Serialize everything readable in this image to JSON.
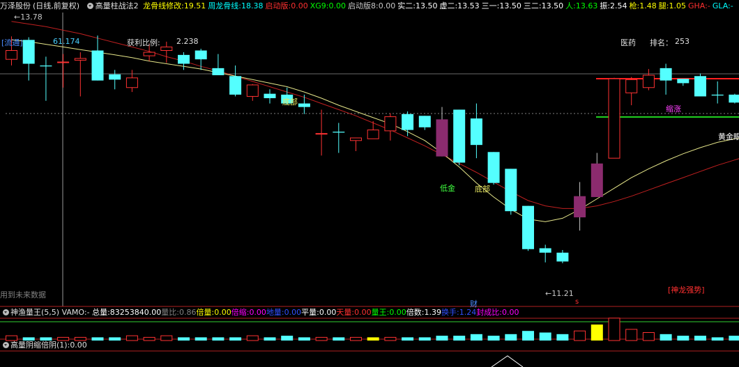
{
  "header": {
    "stock_name": "万泽股份",
    "period": "(日线,前复权)",
    "indicator_name": "高量柱战法2",
    "items": [
      {
        "label": "龙骨线修改:",
        "value": "19.51",
        "color": "#ffff00"
      },
      {
        "label": "周龙骨线:",
        "value": "18.38",
        "color": "#00ffff"
      },
      {
        "label": "启动版:",
        "value": "0.00",
        "color": "#ff3030"
      },
      {
        "label": "XG9:",
        "value": "0.00",
        "color": "#00ff00"
      },
      {
        "label": "启动版8:",
        "value": "0.00",
        "color": "#c8c8c8"
      },
      {
        "label": "实二:",
        "value": "13.50",
        "color": "#ffffff"
      },
      {
        "label": "虚二:",
        "value": "13.53",
        "color": "#ffffff"
      },
      {
        "label": "三一:",
        "value": "13.50",
        "color": "#ffffff"
      },
      {
        "label": "三二:",
        "value": "13.50",
        "color": "#ffffff"
      },
      {
        "label": "人:",
        "value": "13.63",
        "color": "#00ff00"
      },
      {
        "label": "振:",
        "value": "2.54",
        "color": "#ffffff"
      },
      {
        "label": "枪:",
        "value": "1.48",
        "color": "#ffff00"
      },
      {
        "label": "腿:",
        "value": "1.05",
        "color": "#ffff00"
      },
      {
        "label": "GHA:",
        "value": "-",
        "color": "#ff3030"
      },
      {
        "label": "GLA:",
        "value": "-",
        "color": "#00ffff"
      }
    ]
  },
  "main_panel": {
    "price_high_label": "13.78",
    "price_low_label": "11.21",
    "liutong_label": "[流通]",
    "liutong_value": "61.174",
    "profit_ratio_label": "获利比例:",
    "profit_ratio_value": "2.238",
    "sector_name": "医药",
    "rank_label": "排名：",
    "rank_value": "253",
    "future_data_note": "用到未来数据",
    "shenlong_label": "[神龙强势]",
    "annotations": {
      "dibu1": "底部",
      "dibu2": "底部",
      "dijin": "低金",
      "suozhang": "缩涨",
      "huangjin": "黄金眼",
      "cai": "财",
      "s_mark": "s"
    },
    "colors": {
      "up": "#ff3232",
      "down": "#54ffff",
      "ma_yellow": "#e6e68a",
      "ma_red": "#c02020",
      "highlight_candle": "#8b2b6e"
    }
  },
  "volume_panel": {
    "name": "神渔量王(5,5)",
    "vamo_label": "VAMO:",
    "vamo_value": "-",
    "items": [
      {
        "label": "总量:",
        "value": "83253840.00",
        "color": "#ffffff"
      },
      {
        "label": "量比:",
        "value": "0.86",
        "color": "#808080"
      },
      {
        "label": "倍量:",
        "value": "0.00",
        "color": "#ffff00"
      },
      {
        "label": "倍缩:",
        "value": "0.00",
        "color": "#ff00ff"
      },
      {
        "label": "地量:",
        "value": "0.00",
        "color": "#3050ff"
      },
      {
        "label": "平量:",
        "value": "0.00",
        "color": "#ffffff"
      },
      {
        "label": "天量:",
        "value": "0.00",
        "color": "#ff3030"
      },
      {
        "label": "量王:",
        "value": "0.00",
        "color": "#00ff00"
      },
      {
        "label": "倍数:",
        "value": "1.39",
        "color": "#ffffff"
      },
      {
        "label": "换手:",
        "value": "1.24",
        "color": "#3050ff"
      },
      {
        "label": "封成比:",
        "value": "0.00",
        "color": "#ff00ff"
      }
    ]
  },
  "bottom_panel": {
    "name": "高量阴缩倍阴(1)",
    "value": "0.00"
  },
  "chart_data": {
    "type": "candlestick",
    "price_range": [
      10.8,
      14.05
    ],
    "candles": [
      {
        "o": 13.52,
        "h": 13.78,
        "l": 13.45,
        "c": 13.62
      },
      {
        "o": 13.74,
        "h": 13.77,
        "l": 13.28,
        "c": 13.47
      },
      {
        "o": 13.45,
        "h": 13.55,
        "l": 13.05,
        "c": 13.44
      },
      {
        "o": 13.49,
        "h": 13.58,
        "l": 13.2,
        "c": 13.49
      },
      {
        "o": 13.51,
        "h": 13.6,
        "l": 13.1,
        "c": 13.53
      },
      {
        "o": 13.62,
        "h": 13.79,
        "l": 13.28,
        "c": 13.28
      },
      {
        "o": 13.35,
        "h": 13.4,
        "l": 13.18,
        "c": 13.29
      },
      {
        "o": 13.2,
        "h": 13.4,
        "l": 13.15,
        "c": 13.31
      },
      {
        "o": 13.56,
        "h": 13.7,
        "l": 13.5,
        "c": 13.6
      },
      {
        "o": 13.62,
        "h": 13.72,
        "l": 13.48,
        "c": 13.66
      },
      {
        "o": 13.57,
        "h": 13.6,
        "l": 13.4,
        "c": 13.47
      },
      {
        "o": 13.62,
        "h": 13.64,
        "l": 13.4,
        "c": 13.52
      },
      {
        "o": 13.42,
        "h": 13.58,
        "l": 13.34,
        "c": 13.34
      },
      {
        "o": 13.33,
        "h": 13.45,
        "l": 13.1,
        "c": 13.12
      },
      {
        "o": 13.1,
        "h": 13.24,
        "l": 13.05,
        "c": 13.23
      },
      {
        "o": 13.13,
        "h": 13.18,
        "l": 13.02,
        "c": 13.08
      },
      {
        "o": 13.12,
        "h": 13.2,
        "l": 13.0,
        "c": 13.02
      },
      {
        "o": 13.02,
        "h": 13.12,
        "l": 12.9,
        "c": 12.98
      },
      {
        "o": 12.68,
        "h": 12.95,
        "l": 12.43,
        "c": 12.68
      },
      {
        "o": 12.7,
        "h": 12.8,
        "l": 12.46,
        "c": 12.69
      },
      {
        "o": 12.6,
        "h": 12.63,
        "l": 12.48,
        "c": 12.63
      },
      {
        "o": 12.62,
        "h": 12.82,
        "l": 12.62,
        "c": 12.72
      },
      {
        "o": 12.71,
        "h": 12.91,
        "l": 12.6,
        "c": 12.87
      },
      {
        "o": 12.9,
        "h": 12.93,
        "l": 12.65,
        "c": 12.72
      },
      {
        "o": 12.88,
        "h": 12.88,
        "l": 12.72,
        "c": 12.75
      },
      {
        "o": 12.84,
        "h": 12.98,
        "l": 12.42,
        "c": 12.42
      },
      {
        "o": 12.95,
        "h": 12.95,
        "l": 12.32,
        "c": 12.35
      },
      {
        "o": 12.85,
        "h": 13.02,
        "l": 12.4,
        "c": 12.55
      },
      {
        "o": 12.47,
        "h": 12.47,
        "l": 12.1,
        "c": 12.12
      },
      {
        "o": 12.28,
        "h": 12.28,
        "l": 11.76,
        "c": 11.8
      },
      {
        "o": 11.86,
        "h": 11.86,
        "l": 11.35,
        "c": 11.37
      },
      {
        "o": 11.38,
        "h": 11.42,
        "l": 11.22,
        "c": 11.33
      },
      {
        "o": 11.33,
        "h": 11.36,
        "l": 11.21,
        "c": 11.23
      },
      {
        "o": 11.73,
        "h": 12.13,
        "l": 11.58,
        "c": 11.97
      },
      {
        "o": 11.96,
        "h": 12.46,
        "l": 11.96,
        "c": 12.34
      },
      {
        "o": 12.4,
        "h": 13.31,
        "l": 12.4,
        "c": 13.3
      },
      {
        "o": 13.14,
        "h": 13.32,
        "l": 13.0,
        "c": 13.29
      },
      {
        "o": 13.2,
        "h": 13.41,
        "l": 13.17,
        "c": 13.34
      },
      {
        "o": 13.42,
        "h": 13.47,
        "l": 13.12,
        "c": 13.28
      },
      {
        "o": 13.3,
        "h": 13.3,
        "l": 13.22,
        "c": 13.25
      },
      {
        "o": 13.33,
        "h": 13.36,
        "l": 13.12,
        "c": 13.1
      },
      {
        "o": 13.12,
        "h": 13.27,
        "l": 13.02,
        "c": 13.11
      },
      {
        "o": 13.12,
        "h": 13.13,
        "l": 13.02,
        "c": 13.03
      },
      {
        "o": 13.03,
        "h": 13.14,
        "l": 12.94,
        "c": 13.11
      }
    ],
    "highlighted_candles": [
      25,
      33,
      34
    ],
    "volumes": [
      3,
      2,
      2,
      2,
      2,
      2,
      2,
      3,
      2,
      3,
      2,
      2,
      2,
      2,
      3,
      2,
      3,
      2,
      2,
      2,
      2,
      2,
      2,
      2,
      2,
      3,
      3,
      4,
      3,
      4,
      6,
      5,
      4,
      6,
      10,
      14,
      7,
      5,
      4,
      3,
      3,
      2,
      3,
      3
    ],
    "volume_yellow_bars": [
      21,
      34
    ],
    "ma_yellow": [
      13.74,
      13.72,
      13.69,
      13.66,
      13.63,
      13.6,
      13.57,
      13.54,
      13.5,
      13.47,
      13.44,
      13.41,
      13.37,
      13.33,
      13.29,
      13.25,
      13.21,
      13.15,
      13.08,
      13.0,
      12.93,
      12.86,
      12.79,
      12.7,
      12.6,
      12.46,
      12.3,
      12.12,
      11.96,
      11.82,
      11.71,
      11.68,
      11.72,
      11.82,
      11.94,
      12.06,
      12.18,
      12.28,
      12.37,
      12.45,
      12.52,
      12.58,
      12.62,
      12.65
    ],
    "ma_red": [
      13.95,
      13.92,
      13.89,
      13.85,
      13.81,
      13.76,
      13.71,
      13.66,
      13.61,
      13.55,
      13.5,
      13.44,
      13.39,
      13.33,
      13.27,
      13.21,
      13.15,
      13.09,
      13.02,
      12.95,
      12.88,
      12.8,
      12.72,
      12.63,
      12.54,
      12.44,
      12.34,
      12.24,
      12.13,
      12.02,
      11.92,
      11.86,
      11.83,
      11.83,
      11.86,
      11.91,
      11.97,
      12.04,
      12.11,
      12.18,
      12.25,
      12.32,
      12.38,
      12.44
    ]
  }
}
